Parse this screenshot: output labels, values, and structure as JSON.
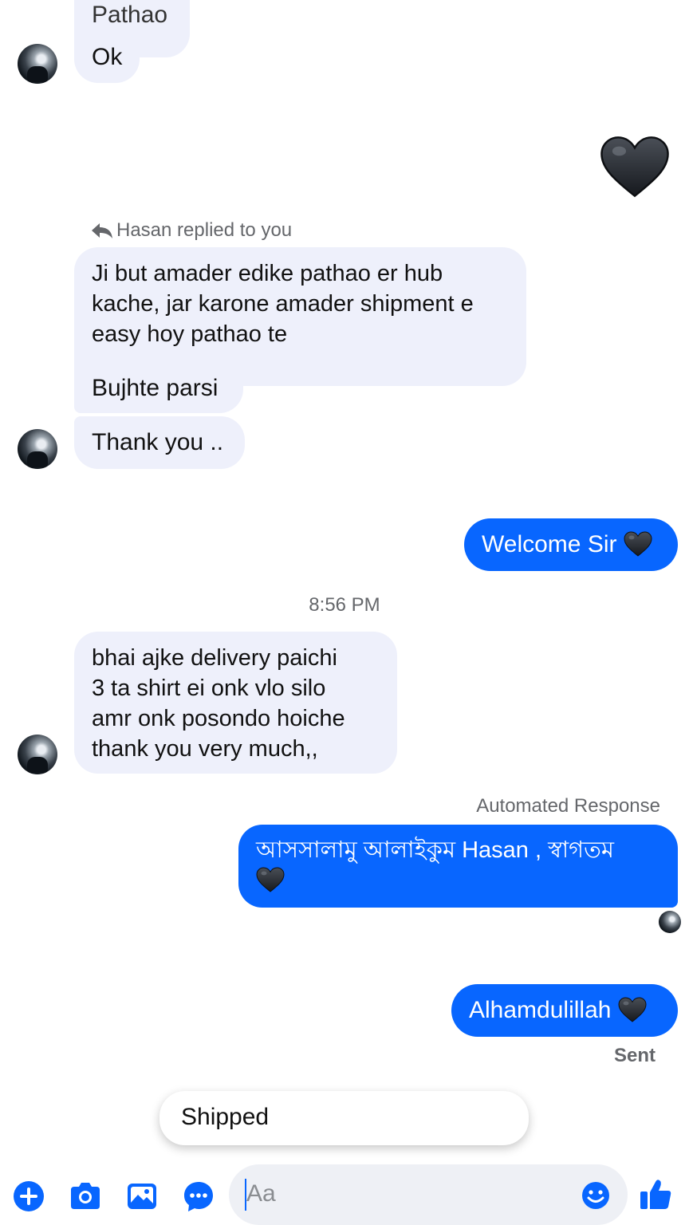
{
  "messages": {
    "top_partial": "Pathao",
    "ok": "Ok",
    "reply_label": "Hasan replied to you",
    "reply_text": "Ji but amader edike pathao er hub kache, jar karone amader shipment e easy hoy pathao te",
    "bujhte": "Bujhte parsi",
    "thank_you": "Thank you ..",
    "welcome": "Welcome Sir",
    "timestamp": "8:56 PM",
    "delivery_lines": [
      "bhai ajke delivery paichi",
      "3 ta shirt ei onk vlo silo",
      "amr onk posondo hoiche",
      "thank you very much,,"
    ],
    "automated_label": "Automated Response",
    "auto_reply": "আসসালামু আলাইকুম Hasan ,  স্বাগতম",
    "alhamdulillah": "Alhamdulillah",
    "sent_status": "Sent"
  },
  "suggestion": {
    "label": "Shipped"
  },
  "composer": {
    "placeholder": "Aa"
  },
  "icons": {
    "heart": "black-heart-emoji",
    "reply": "reply-arrow-icon",
    "plus": "plus-circle-icon",
    "camera": "camera-icon",
    "gallery": "image-icon",
    "chat": "chat-bubble-icon",
    "emoji": "smiley-icon",
    "like": "thumbs-up-icon"
  },
  "colors": {
    "accent": "#0866ff",
    "incoming_bubble": "#eef0fb",
    "meta_text": "#65676b"
  }
}
